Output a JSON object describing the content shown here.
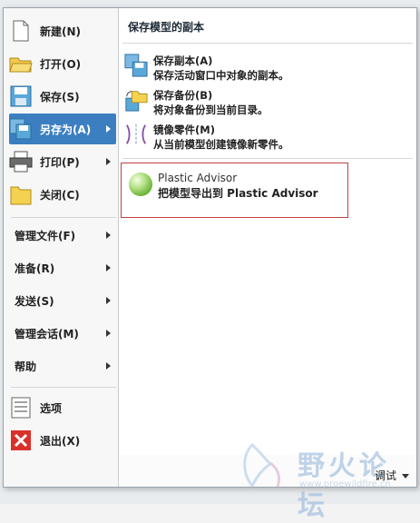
{
  "left_menu": {
    "top_items": [
      {
        "label": "新建(N)",
        "icon": "new-file-icon"
      },
      {
        "label": "打开(O)",
        "icon": "open-folder-icon"
      },
      {
        "label": "保存(S)",
        "icon": "save-disk-icon"
      },
      {
        "label": "另存为(A)",
        "icon": "save-as-icon",
        "selected": true,
        "submenu": true
      },
      {
        "label": "打印(P)",
        "icon": "printer-icon",
        "submenu": true
      },
      {
        "label": "关闭(C)",
        "icon": "close-folder-icon"
      }
    ],
    "text_items": [
      {
        "label": "管理文件(F)"
      },
      {
        "label": "准备(R)"
      },
      {
        "label": "发送(S)"
      },
      {
        "label": "管理会话(M)"
      },
      {
        "label": "帮助"
      }
    ],
    "bottom_items": [
      {
        "label": "选项",
        "icon": "options-list-icon"
      },
      {
        "label": "退出(X)",
        "icon": "exit-x-icon"
      }
    ]
  },
  "submenu": {
    "title": "保存模型的副本",
    "entries": [
      {
        "title": "保存副本(A)",
        "desc": "保存活动窗口中对象的副本。",
        "icon": "save-copy-icon"
      },
      {
        "title": "保存备份(B)",
        "desc": "将对象备份到当前目录。",
        "icon": "save-backup-icon"
      },
      {
        "title": "镜像零件(M)",
        "desc": "从当前模型创建镜像新零件。",
        "icon": "mirror-part-icon"
      }
    ],
    "advisor": {
      "title": "Plastic Advisor",
      "desc": "把模型导出到 Plastic Advisor",
      "icon": "plastic-advisor-sphere-icon"
    }
  },
  "watermark": {
    "text": "野火论坛",
    "url": "www.proewildfire.cn"
  },
  "debug_label": "调试",
  "colors": {
    "selected": "#3c7fc1",
    "advisor_border": "#c04040"
  }
}
